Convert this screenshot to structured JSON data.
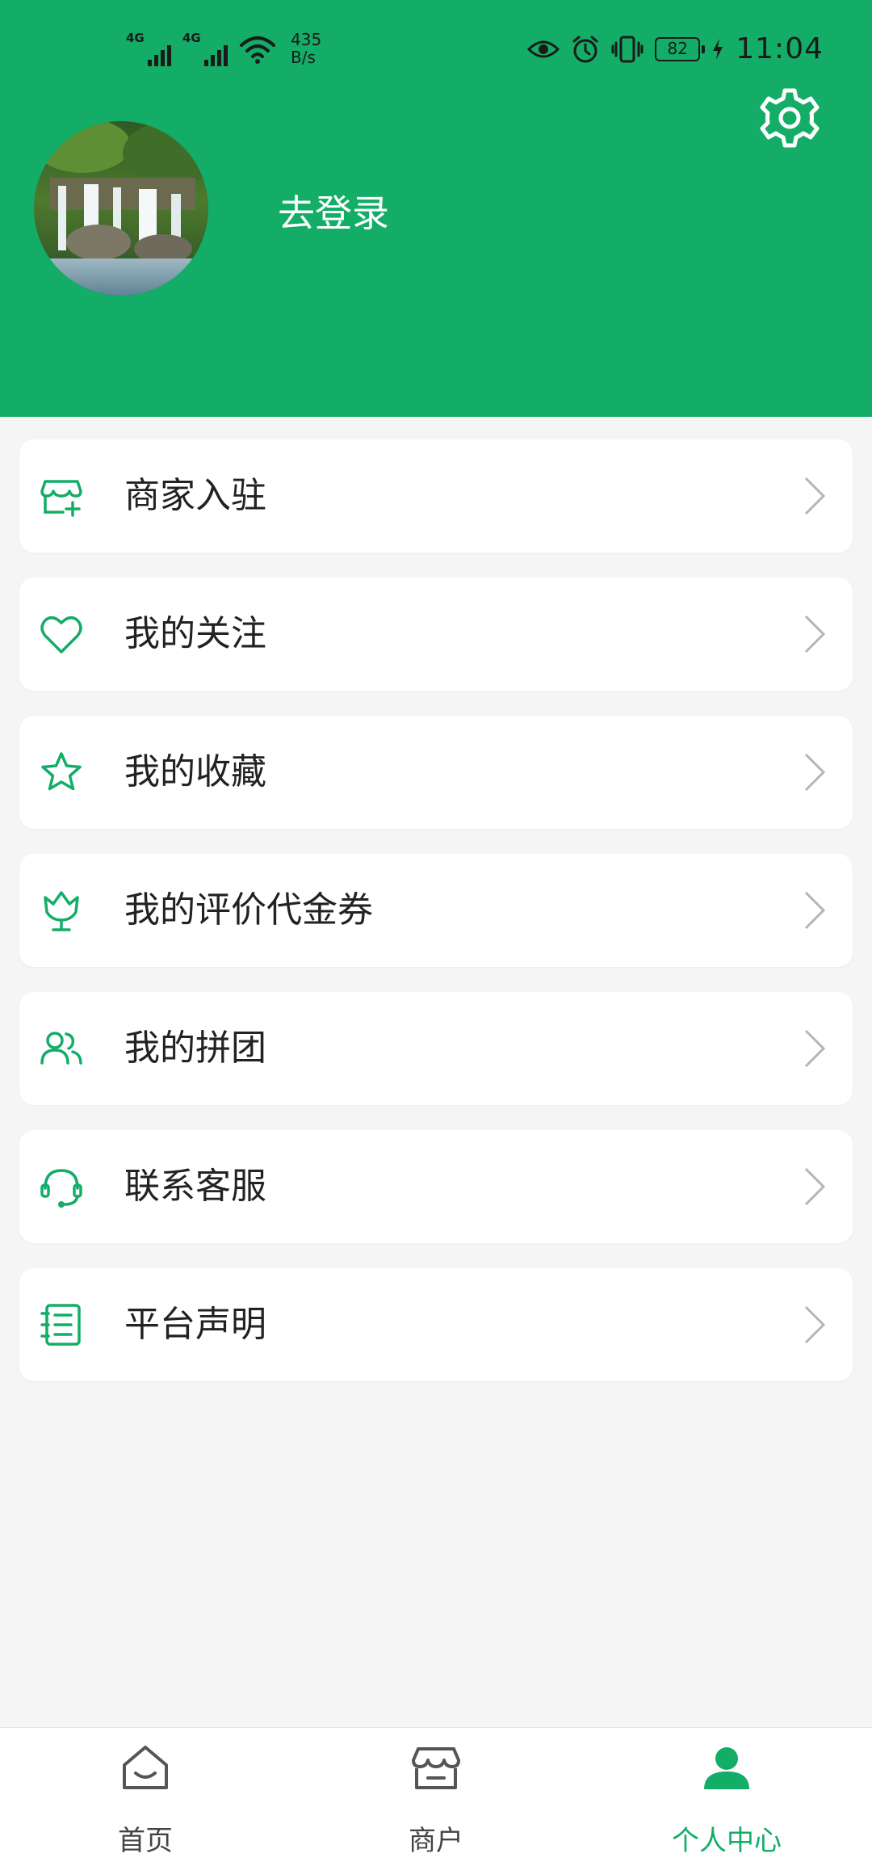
{
  "status_bar": {
    "signal_1_type": "4G",
    "signal_2_type": "4G",
    "net_speed_value": "435",
    "net_speed_unit": "B/s",
    "battery_level": "82",
    "time": "11:04"
  },
  "colors": {
    "brand_green": "#13ad67",
    "page_background": "#f5f5f5",
    "card_background": "#ffffff"
  },
  "header": {
    "avatar_icon": "waterfall-avatar",
    "login_text": "去登录",
    "settings_icon": "gear-icon"
  },
  "menu": {
    "items": [
      {
        "icon": "store-add-icon",
        "label": "商家入驻"
      },
      {
        "icon": "heart-icon",
        "label": "我的关注"
      },
      {
        "icon": "star-icon",
        "label": "我的收藏"
      },
      {
        "icon": "tulip-icon",
        "label": "我的评价代金券"
      },
      {
        "icon": "group-icon",
        "label": "我的拼团"
      },
      {
        "icon": "headset-icon",
        "label": "联系客服"
      },
      {
        "icon": "document-icon",
        "label": "平台声明"
      }
    ]
  },
  "tabbar": {
    "tabs": [
      {
        "icon": "home-icon",
        "label": "首页",
        "active": false
      },
      {
        "icon": "shop-icon",
        "label": "商户",
        "active": false
      },
      {
        "icon": "person-icon",
        "label": "个人中心",
        "active": true
      }
    ]
  }
}
